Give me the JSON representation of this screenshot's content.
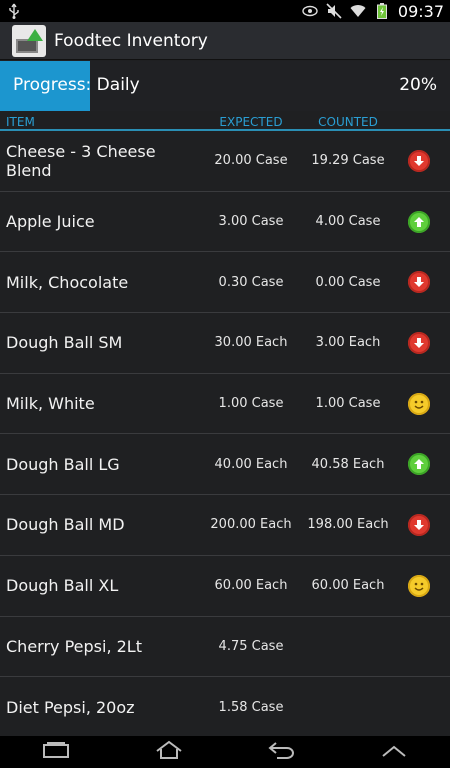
{
  "status_bar": {
    "time": "09:37",
    "icons": [
      "usb-icon",
      "eye-icon",
      "mute-icon",
      "wifi-icon",
      "battery-icon"
    ]
  },
  "app": {
    "title": "Foodtec Inventory",
    "icon": "app-icon"
  },
  "progress": {
    "label": "Progress: Daily",
    "percent_text": "20%",
    "value": 0.2,
    "color": "#1c96cf"
  },
  "columns": {
    "item": "ITEM",
    "expected": "EXPECTED",
    "counted": "COUNTED"
  },
  "rows": [
    {
      "name": "Cheese - 3 Cheese Blend",
      "expected": "20.00 Case",
      "counted": "19.29 Case",
      "status": "down"
    },
    {
      "name": "Apple Juice",
      "expected": "3.00 Case",
      "counted": "4.00 Case",
      "status": "up"
    },
    {
      "name": "Milk, Chocolate",
      "expected": "0.30 Case",
      "counted": "0.00 Case",
      "status": "down"
    },
    {
      "name": "Dough Ball SM",
      "expected": "30.00 Each",
      "counted": "3.00 Each",
      "status": "down"
    },
    {
      "name": "Milk, White",
      "expected": "1.00 Case",
      "counted": "1.00 Case",
      "status": "ok"
    },
    {
      "name": "Dough Ball LG",
      "expected": "40.00 Each",
      "counted": "40.58 Each",
      "status": "up"
    },
    {
      "name": "Dough Ball MD",
      "expected": "200.00 Each",
      "counted": "198.00 Each",
      "status": "down"
    },
    {
      "name": "Dough Ball XL",
      "expected": "60.00 Each",
      "counted": "60.00 Each",
      "status": "ok"
    },
    {
      "name": "Cherry Pepsi, 2Lt",
      "expected": "4.75 Case",
      "counted": "",
      "status": ""
    },
    {
      "name": "Diet Pepsi, 20oz",
      "expected": "1.58 Case",
      "counted": "",
      "status": ""
    }
  ],
  "status_icons": {
    "down": "arrow-down-red-icon",
    "up": "arrow-up-green-icon",
    "ok": "smiley-icon"
  },
  "nav": [
    "recent-apps-icon",
    "home-icon",
    "back-icon",
    "up-chevron-icon"
  ]
}
